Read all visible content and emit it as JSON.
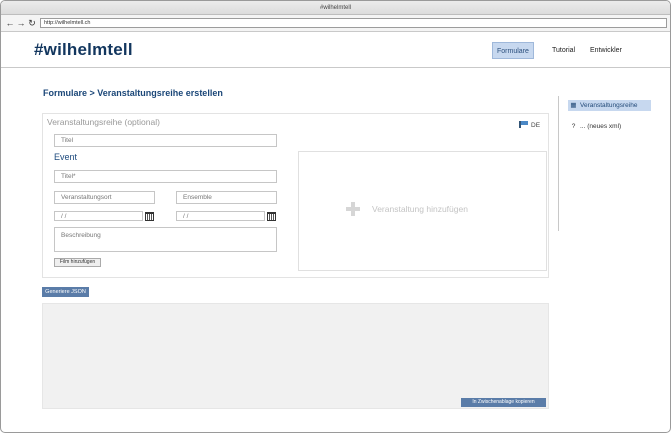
{
  "browser": {
    "window_title": "#wilhelmtell",
    "url": "http://wilhelmtell.ch",
    "back_icon": "arrow-left-icon",
    "forward_icon": "arrow-right-icon",
    "reload_icon": "reload-icon"
  },
  "header": {
    "logo": "#wilhelmtell",
    "nav": [
      {
        "label": "Formulare",
        "active": true
      },
      {
        "label": "Tutorial",
        "active": false
      },
      {
        "label": "Entwickler",
        "active": false
      }
    ]
  },
  "breadcrumb": "Formulare > Veranstaltungsreihe erstellen",
  "form": {
    "title": "Veranstaltungsreihe (optional)",
    "language": "DE",
    "series_title_placeholder": "Titel",
    "event_heading": "Event",
    "event_title_placeholder": "Titel*",
    "venue_placeholder": "Veranstaltungsort",
    "ensemble_placeholder": "Ensemble",
    "date_from": "/  /",
    "date_to": "/  /",
    "description_placeholder": "Beschreibung",
    "add_film_button": "Film hinzufügen",
    "add_event_label": "Veranstaltung hinzufügen"
  },
  "output": {
    "generate_button": "Generiere JSON",
    "copy_button": "In Zwischenablage kopieren"
  },
  "sidebar": {
    "items": [
      {
        "label": "Veranstaltungsreihe",
        "icon": "calendar-icon",
        "active": true
      },
      {
        "label": "... (neues xml)",
        "icon": "help-icon",
        "active": false
      }
    ]
  }
}
